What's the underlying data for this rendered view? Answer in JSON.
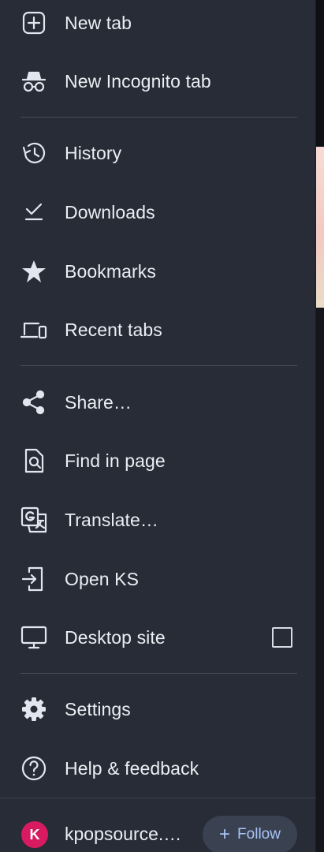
{
  "menu": {
    "items": [
      {
        "label": "New tab",
        "icon": "add-box-icon"
      },
      {
        "label": "New Incognito tab",
        "icon": "incognito-icon"
      },
      {
        "label": "History",
        "icon": "history-icon"
      },
      {
        "label": "Downloads",
        "icon": "download-check-icon"
      },
      {
        "label": "Bookmarks",
        "icon": "star-icon"
      },
      {
        "label": "Recent tabs",
        "icon": "devices-icon"
      },
      {
        "label": "Share…",
        "icon": "share-icon"
      },
      {
        "label": "Find in page",
        "icon": "find-in-page-icon"
      },
      {
        "label": "Translate…",
        "icon": "translate-icon"
      },
      {
        "label": "Open KS",
        "icon": "open-in-app-icon"
      },
      {
        "label": "Desktop site",
        "icon": "desktop-icon",
        "checked": false
      },
      {
        "label": "Settings",
        "icon": "gear-icon"
      },
      {
        "label": "Help & feedback",
        "icon": "help-icon"
      }
    ]
  },
  "footer": {
    "avatar_letter": "K",
    "avatar_color": "#d81b60",
    "site_name": "kpopsource.…",
    "follow_label": "Follow"
  }
}
